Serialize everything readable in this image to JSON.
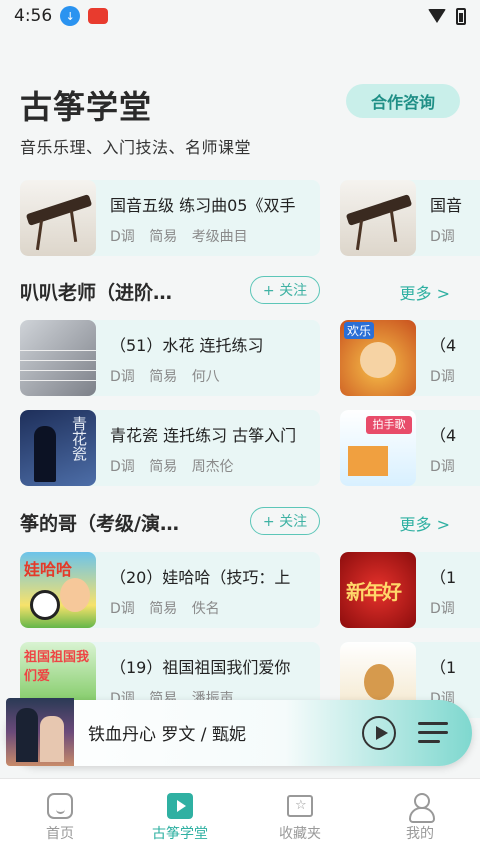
{
  "status_bar": {
    "time": "4:56"
  },
  "header": {
    "title": "古筝学堂",
    "subtitle": "音乐乐理、入门技法、名师课堂",
    "coop_button": "合作咨询"
  },
  "top_row": [
    {
      "title": "国音五级 练习曲05《双手",
      "key": "D调",
      "level": "简易",
      "author": "考级曲目"
    },
    {
      "title": "国音",
      "key": "D调",
      "level": "",
      "author": ""
    }
  ],
  "sections": [
    {
      "title": "叭叭老师（进阶…",
      "follow": "+ 关注",
      "more": "更多 >",
      "rows": [
        [
          {
            "title": "（51）水花 连托练习",
            "key": "D调",
            "level": "简易",
            "author": "何八"
          },
          {
            "title": "（4",
            "key": "D调",
            "level": "",
            "author": "",
            "badge": "欢乐"
          }
        ],
        [
          {
            "title": "青花瓷 连托练习 古筝入门",
            "key": "D调",
            "level": "简易",
            "author": "周杰伦",
            "thumb_text": "青花瓷"
          },
          {
            "title": "（4",
            "key": "D调",
            "level": "",
            "author": "",
            "thumb_text": "拍手歌"
          }
        ]
      ]
    },
    {
      "title": "筝的哥（考级/演…",
      "follow": "+ 关注",
      "more": "更多 >",
      "rows": [
        [
          {
            "title": "（20）娃哈哈（技巧：上",
            "key": "D调",
            "level": "简易",
            "author": "佚名",
            "thumb_text": "娃哈哈"
          },
          {
            "title": "（1",
            "key": "D调",
            "level": "",
            "author": "",
            "thumb_text": "新年好"
          }
        ],
        [
          {
            "title": "（19）祖国祖国我们爱你",
            "key": "D调",
            "level": "简易",
            "author": "潘振声",
            "thumb_text": "祖国祖国我们爱"
          },
          {
            "title": "（1",
            "key": "D调",
            "level": "",
            "author": ""
          }
        ]
      ]
    }
  ],
  "player": {
    "title": "铁血丹心 罗文 / 甄妮"
  },
  "tabs": [
    {
      "label": "首页",
      "icon": "home-icon"
    },
    {
      "label": "古筝学堂",
      "icon": "play-icon"
    },
    {
      "label": "收藏夹",
      "icon": "folder-star-icon"
    },
    {
      "label": "我的",
      "icon": "user-icon"
    }
  ],
  "colors": {
    "accent": "#2fb0a2",
    "card_bg": "#e9f6f5",
    "button_bg": "#c9efea"
  }
}
